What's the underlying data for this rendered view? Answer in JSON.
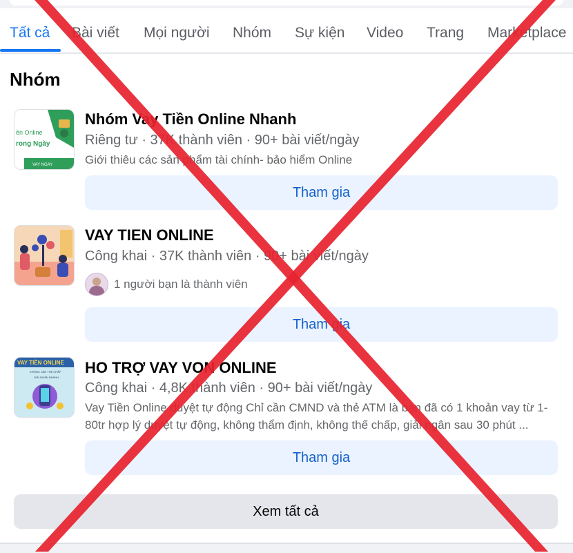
{
  "tabs": [
    {
      "label": "Tất cả",
      "active": true
    },
    {
      "label": "Bài viết"
    },
    {
      "label": "Mọi người"
    },
    {
      "label": "Nhóm"
    },
    {
      "label": "Sự kiện"
    },
    {
      "label": "Video"
    },
    {
      "label": "Trang"
    },
    {
      "label": "Marketplace"
    }
  ],
  "section_title": "Nhóm",
  "groups": [
    {
      "name": "Nhóm Vay Tiền Online Nhanh",
      "meta": "Riêng tư · 37K thành viên · 90+ bài viết/ngày",
      "description": "Giới thiêu các sản phẩm tài chính- bảo hiểm Online",
      "thumb_text": [
        "ền Online",
        "rong Ngày",
        "VAY NGAY"
      ],
      "join_label": "Tham gia"
    },
    {
      "name": "VAY TIEN ONLINE",
      "meta": "Công khai · 37K thành viên · 90+ bài viết/ngày",
      "friend_text": "1 người bạn là thành viên",
      "join_label": "Tham gia"
    },
    {
      "name": "HO TRỢ VAY VON ONLINE",
      "meta": "Công khai · 4,8K thành viên · 90+ bài viết/ngày",
      "description": "Vay Tiền Online duyệt tự động Chỉ cần CMND và thẻ ATM là bạn đã có 1 khoản vay từ 1-80tr hợp lý duyệt tự động, không thẩm định, không thế chấp, giải ngân sau 30 phút ...",
      "thumb_text": [
        "VAY TIỀN ONLINE",
        "KHÔNG CẦN THẾ CHẤP",
        "GIẢI NGÂN NHANH"
      ],
      "join_label": "Tham gia"
    }
  ],
  "see_all_label": "Xem tất cả",
  "colors": {
    "accent": "#1877f2",
    "join_bg": "#eaf3ff",
    "join_text": "#1561c9",
    "cross": "#e8232f"
  }
}
